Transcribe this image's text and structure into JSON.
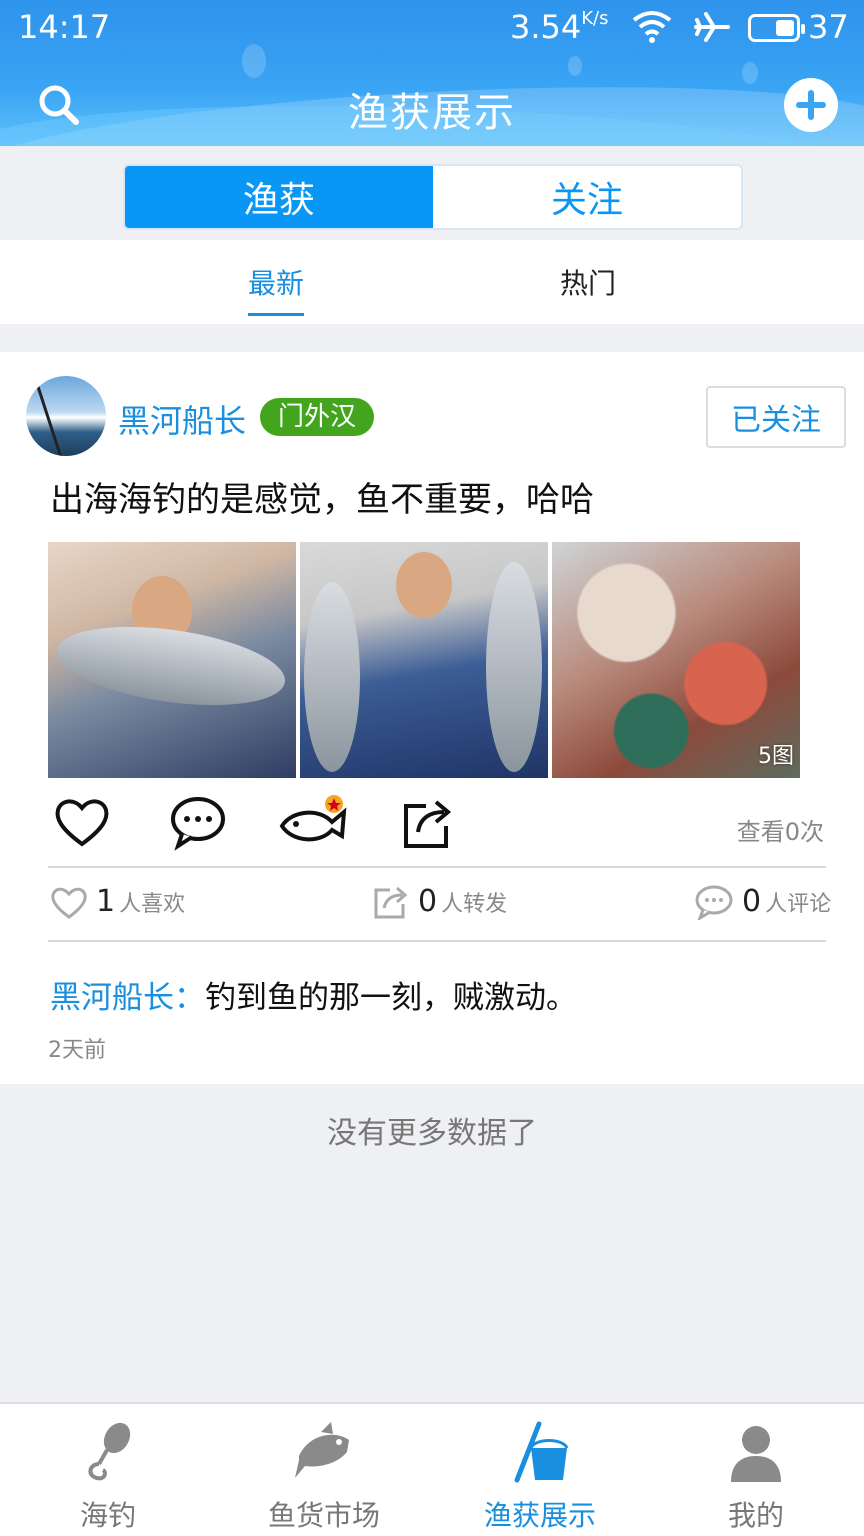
{
  "status_bar": {
    "time": "14:17",
    "speed": "3.54",
    "speed_unit": "K/s",
    "battery": "37"
  },
  "header": {
    "title": "渔获展示",
    "search_icon": "search-icon",
    "add_icon": "add-circle-icon"
  },
  "segment": {
    "tabs": [
      {
        "label": "渔获",
        "active": true
      },
      {
        "label": "关注",
        "active": false
      }
    ]
  },
  "sort": {
    "tabs": [
      {
        "label": "最新",
        "active": true
      },
      {
        "label": "热门",
        "active": false
      }
    ]
  },
  "post": {
    "username": "黑河船长",
    "badge": "门外汉",
    "follow_label": "已关注",
    "text": "出海海钓的是感觉，鱼不重要，哈哈",
    "photo_count_tag": "5图",
    "views": "查看0次",
    "likes": {
      "count": "1",
      "label": "人喜欢"
    },
    "shares": {
      "count": "0",
      "label": "人转发"
    },
    "comments": {
      "count": "0",
      "label": "人评论"
    },
    "comment": {
      "author": "黑河船长：",
      "text": "钓到鱼的那一刻，贼激动。"
    },
    "time_ago": "2天前"
  },
  "footer_text": "没有更多数据了",
  "colors": {
    "accent": "#1a8fe0",
    "header": "#3aa4f4",
    "badge": "#43a51e"
  },
  "bottom_nav": {
    "items": [
      {
        "label": "海钓",
        "icon": "fishing-hook-icon",
        "active": false
      },
      {
        "label": "鱼货市场",
        "icon": "fish-market-icon",
        "active": false
      },
      {
        "label": "渔获展示",
        "icon": "catch-bucket-icon",
        "active": true
      },
      {
        "label": "我的",
        "icon": "user-icon",
        "active": false
      }
    ]
  }
}
